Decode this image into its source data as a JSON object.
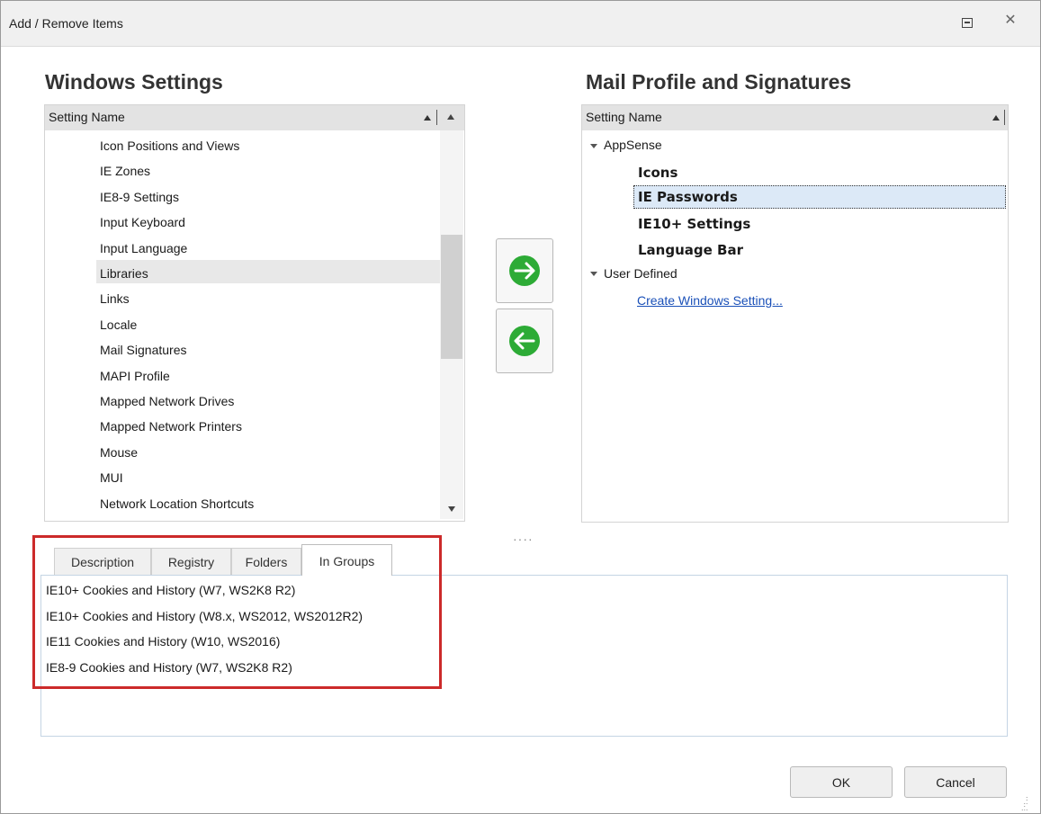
{
  "window": {
    "title": "Add / Remove Items"
  },
  "left_panel": {
    "title": "Windows Settings",
    "column_header": "Setting Name",
    "items": [
      "Icon Positions and Views",
      "IE Zones",
      "IE8-9 Settings",
      "Input Keyboard",
      "Input Language",
      "Libraries",
      "Links",
      "Locale",
      "Mail Signatures",
      "MAPI Profile",
      "Mapped Network Drives",
      "Mapped Network Printers",
      "Mouse",
      "MUI",
      "Network Location Shortcuts"
    ],
    "hovered_item": "Libraries"
  },
  "move_buttons": {
    "add_icon": "arrow-right-circle-icon",
    "remove_icon": "arrow-left-circle-icon",
    "color": "#2dab36"
  },
  "right_panel": {
    "title": "Mail Profile and Signatures",
    "column_header": "Setting Name",
    "groups": [
      {
        "label": "AppSense",
        "children": [
          "Icons",
          "IE Passwords",
          "IE10+ Settings",
          "Language Bar"
        ]
      },
      {
        "label": "User Defined",
        "link": "Create Windows Setting..."
      }
    ],
    "selected_item": "IE Passwords"
  },
  "tabs": [
    "Description",
    "Registry",
    "Folders",
    "In Groups"
  ],
  "active_tab": "In Groups",
  "in_groups": [
    "IE10+ Cookies and History (W7, WS2K8 R2)",
    "IE10+ Cookies and History (W8.x, WS2012, WS2012R2)",
    "IE11 Cookies and History (W10, WS2016)",
    "IE8-9 Cookies and History (W7, WS2K8 R2)"
  ],
  "highlight_color": "#cc2a2a",
  "buttons": {
    "ok": "OK",
    "cancel": "Cancel"
  }
}
